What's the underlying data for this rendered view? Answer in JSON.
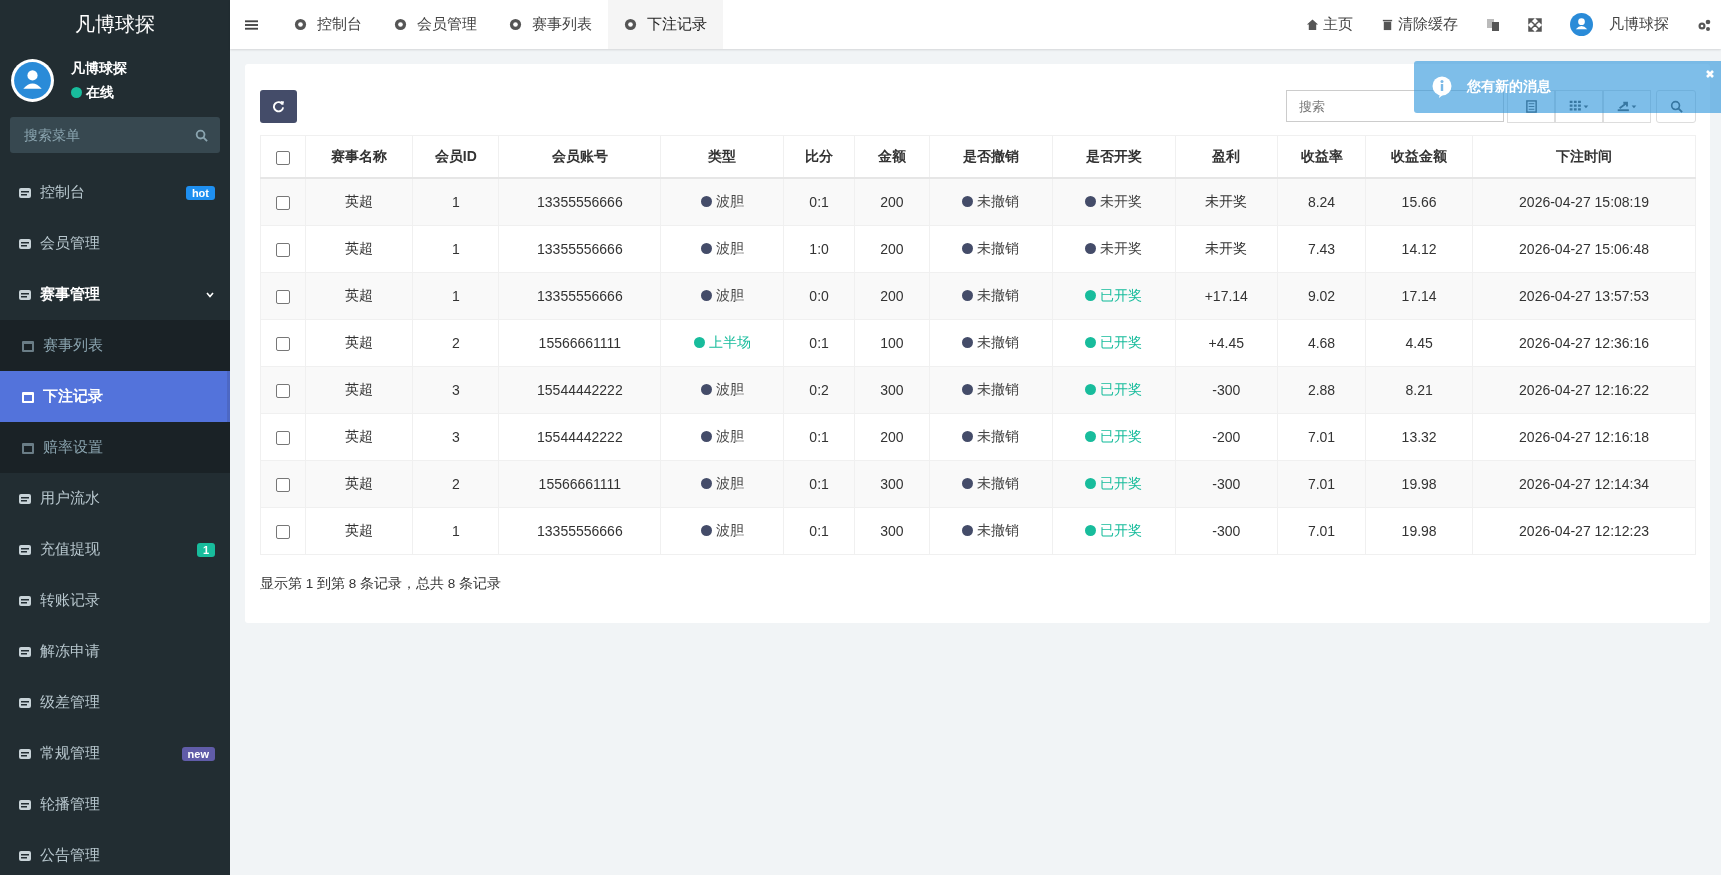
{
  "sidebar": {
    "logo": "凡博球探",
    "user": {
      "name": "凡博球探",
      "status": "在线"
    },
    "search": {
      "placeholder": "搜索菜单"
    },
    "items": [
      {
        "label": "控制台",
        "badge": {
          "text": "hot",
          "color": "#1e8ff0"
        },
        "selected": false
      },
      {
        "label": "会员管理",
        "selected": false
      },
      {
        "label": "赛事管理",
        "expanded": true,
        "selected": false,
        "children": [
          {
            "label": "赛事列表",
            "selected": false
          },
          {
            "label": "下注记录",
            "selected": true
          },
          {
            "label": "赔率设置",
            "selected": false
          }
        ]
      },
      {
        "label": "用户流水",
        "selected": false
      },
      {
        "label": "充值提现",
        "badge": {
          "text": "1",
          "color": "#18bc9c"
        },
        "selected": false
      },
      {
        "label": "转账记录",
        "selected": false
      },
      {
        "label": "解冻申请",
        "selected": false
      },
      {
        "label": "级差管理",
        "selected": false
      },
      {
        "label": "常规管理",
        "badge": {
          "text": "new",
          "color": "#605ca8"
        },
        "selected": false
      },
      {
        "label": "轮播管理",
        "selected": false
      },
      {
        "label": "公告管理",
        "selected": false
      }
    ]
  },
  "tabs": [
    {
      "label": "控制台",
      "selected": false
    },
    {
      "label": "会员管理",
      "selected": false
    },
    {
      "label": "赛事列表",
      "selected": false
    },
    {
      "label": "下注记录",
      "selected": true
    }
  ],
  "top_links": {
    "home": "主页",
    "clear_cache": "清除缓存",
    "user": "凡博球探"
  },
  "notification": {
    "text": "您有新的消息"
  },
  "search": {
    "placeholder": "搜索"
  },
  "table": {
    "select_all": {
      "checked": false
    },
    "columns": [
      "赛事名称",
      "会员ID",
      "会员账号",
      "类型",
      "比分",
      "金额",
      "是否撤销",
      "是否开奖",
      "盈利",
      "收益率",
      "收益金额",
      "下注时间"
    ],
    "rows": [
      {
        "checked": false,
        "cells": [
          "英超",
          "1",
          "13355556666",
          {
            "text": "波胆",
            "color": "#444c69"
          },
          "0:1",
          "200",
          {
            "text": "未撤销",
            "color": "#444c69"
          },
          {
            "text": "未开奖",
            "color": "#444c69"
          },
          "未开奖",
          "8.24",
          "15.66",
          "2026-04-27 15:08:19"
        ]
      },
      {
        "checked": false,
        "cells": [
          "英超",
          "1",
          "13355556666",
          {
            "text": "波胆",
            "color": "#444c69"
          },
          "1:0",
          "200",
          {
            "text": "未撤销",
            "color": "#444c69"
          },
          {
            "text": "未开奖",
            "color": "#444c69"
          },
          "未开奖",
          "7.43",
          "14.12",
          "2026-04-27 15:06:48"
        ]
      },
      {
        "checked": false,
        "cells": [
          "英超",
          "1",
          "13355556666",
          {
            "text": "波胆",
            "color": "#444c69"
          },
          "0:0",
          "200",
          {
            "text": "未撤销",
            "color": "#444c69"
          },
          {
            "text": "已开奖",
            "color": "#18bc9c"
          },
          "+17.14",
          "9.02",
          "17.14",
          "2026-04-27 13:57:53"
        ]
      },
      {
        "checked": false,
        "cells": [
          "英超",
          "2",
          "15566661111",
          {
            "text": "上半场",
            "color": "#18bc9c"
          },
          "0:1",
          "100",
          {
            "text": "未撤销",
            "color": "#444c69"
          },
          {
            "text": "已开奖",
            "color": "#18bc9c"
          },
          "+4.45",
          "4.68",
          "4.45",
          "2026-04-27 12:36:16"
        ]
      },
      {
        "checked": false,
        "cells": [
          "英超",
          "3",
          "15544442222",
          {
            "text": "波胆",
            "color": "#444c69"
          },
          "0:2",
          "300",
          {
            "text": "未撤销",
            "color": "#444c69"
          },
          {
            "text": "已开奖",
            "color": "#18bc9c"
          },
          "-300",
          "2.88",
          "8.21",
          "2026-04-27 12:16:22"
        ]
      },
      {
        "checked": false,
        "cells": [
          "英超",
          "3",
          "15544442222",
          {
            "text": "波胆",
            "color": "#444c69"
          },
          "0:1",
          "200",
          {
            "text": "未撤销",
            "color": "#444c69"
          },
          {
            "text": "已开奖",
            "color": "#18bc9c"
          },
          "-200",
          "7.01",
          "13.32",
          "2026-04-27 12:16:18"
        ]
      },
      {
        "checked": false,
        "cells": [
          "英超",
          "2",
          "15566661111",
          {
            "text": "波胆",
            "color": "#444c69"
          },
          "0:1",
          "300",
          {
            "text": "未撤销",
            "color": "#444c69"
          },
          {
            "text": "已开奖",
            "color": "#18bc9c"
          },
          "-300",
          "7.01",
          "19.98",
          "2026-04-27 12:14:34"
        ]
      },
      {
        "checked": false,
        "cells": [
          "英超",
          "1",
          "13355556666",
          {
            "text": "波胆",
            "color": "#444c69"
          },
          "0:1",
          "300",
          {
            "text": "未撤销",
            "color": "#444c69"
          },
          {
            "text": "已开奖",
            "color": "#18bc9c"
          },
          "-300",
          "7.01",
          "19.98",
          "2026-04-27 12:12:23"
        ]
      }
    ]
  },
  "pagination_info": "显示第 1 到第 8 条记录，总共 8 条记录"
}
